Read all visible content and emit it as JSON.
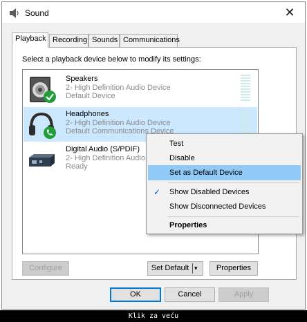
{
  "window": {
    "title": "Sound",
    "close_glyph": "✕"
  },
  "tabs": [
    {
      "label": "Playback",
      "active": true
    },
    {
      "label": "Recording",
      "active": false
    },
    {
      "label": "Sounds",
      "active": false
    },
    {
      "label": "Communications",
      "active": false
    }
  ],
  "instruction": "Select a playback device below to modify its settings:",
  "devices": [
    {
      "name": "Speakers",
      "driver": "2- High Definition Audio Device",
      "status": "Default Device",
      "icon": "speakers-icon",
      "badge": "checkmark",
      "selected": false
    },
    {
      "name": "Headphones",
      "driver": "2- High Definition Audio Device",
      "status": "Default Communications Device",
      "icon": "headphones-icon",
      "badge": "phone",
      "selected": true
    },
    {
      "name": "Digital Audio (S/PDIF)",
      "driver": "2- High Definition Audio Device",
      "status": "Ready",
      "icon": "digital-audio-icon",
      "badge": "none",
      "selected": false
    }
  ],
  "buttons": {
    "configure": "Configure",
    "set_default": "Set Default",
    "set_default_arrow": "▾",
    "properties": "Properties",
    "ok": "OK",
    "cancel": "Cancel",
    "apply": "Apply"
  },
  "context_menu": {
    "test": "Test",
    "disable": "Disable",
    "set_default_device": "Set as Default Device",
    "show_disabled": "Show Disabled Devices",
    "show_disabled_checked": true,
    "show_disconnected": "Show Disconnected Devices",
    "properties": "Properties",
    "check_glyph": "✓"
  },
  "caption": "Klik za veću",
  "colors": {
    "selection": "#cce8ff",
    "menu_hover": "#91c9f7",
    "accent": "#0078d7",
    "badge_green": "#1f9e3a"
  }
}
